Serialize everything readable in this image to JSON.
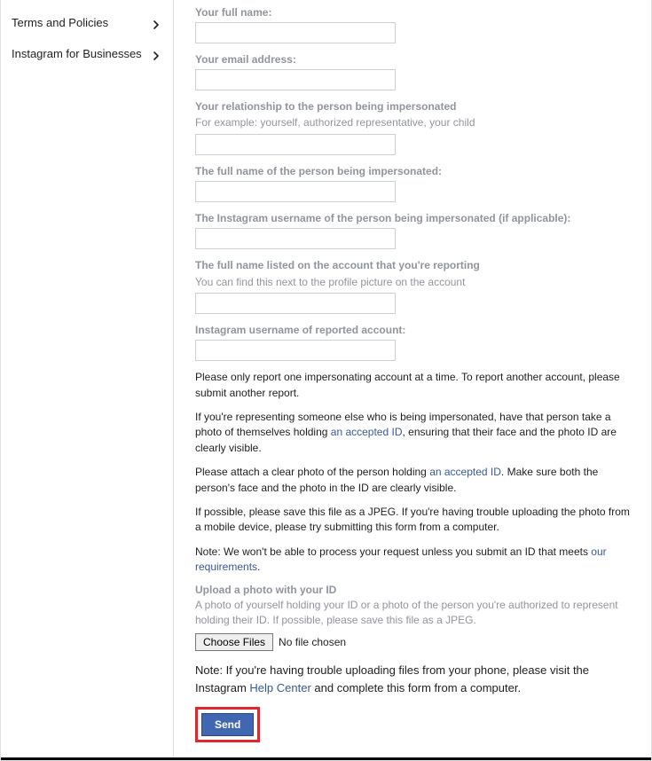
{
  "sidebar": {
    "items": [
      {
        "label": "Terms and Policies"
      },
      {
        "label": "Instagram for Businesses"
      }
    ]
  },
  "form": {
    "full_name_label": "Your full name:",
    "email_label": "Your email address:",
    "relationship_label": "Your relationship to the person being impersonated",
    "relationship_hint": "For example: yourself, authorized representative, your child",
    "impersonated_name_label": "The full name of the person being impersonated:",
    "impersonated_username_label": "The Instagram username of the person being impersonated (if applicable):",
    "reported_fullname_label": "The full name listed on the account that you're reporting",
    "reported_fullname_hint": "You can find this next to the profile picture on the account",
    "reported_username_label": "Instagram username of reported account:"
  },
  "paragraphs": {
    "p1": "Please only report one impersonating account at a time. To report another account, please submit another report.",
    "p2a": "If you're representing someone else who is being impersonated, have that person take a photo of themselves holding ",
    "p2_link": "an accepted ID",
    "p2b": ", ensuring that their face and the photo ID are clearly visible.",
    "p3a": "Please attach a clear photo of the person holding ",
    "p3_link": "an accepted ID",
    "p3b": ". Make sure both the person's face and the photo in the ID are clearly visible.",
    "p4": "If possible, please save this file as a JPEG. If you're having trouble uploading the photo from a mobile device, please try submitting this form from a computer.",
    "p5a": "Note: We won't be able to process your request unless you submit an ID that meets ",
    "p5_link": "our requirements",
    "p5b": "."
  },
  "upload": {
    "label": "Upload a photo with your ID",
    "hint": "A photo of yourself holding your ID or a photo of the person you're authorized to represent holding their ID. If possible, please save this file as a JPEG.",
    "button": "Choose Files",
    "status": "No file chosen"
  },
  "note": {
    "a": "Note: If you're having trouble uploading files from your phone, please visit the Instagram ",
    "link": "Help Center",
    "b": " and complete this form from a computer."
  },
  "actions": {
    "send": "Send"
  }
}
